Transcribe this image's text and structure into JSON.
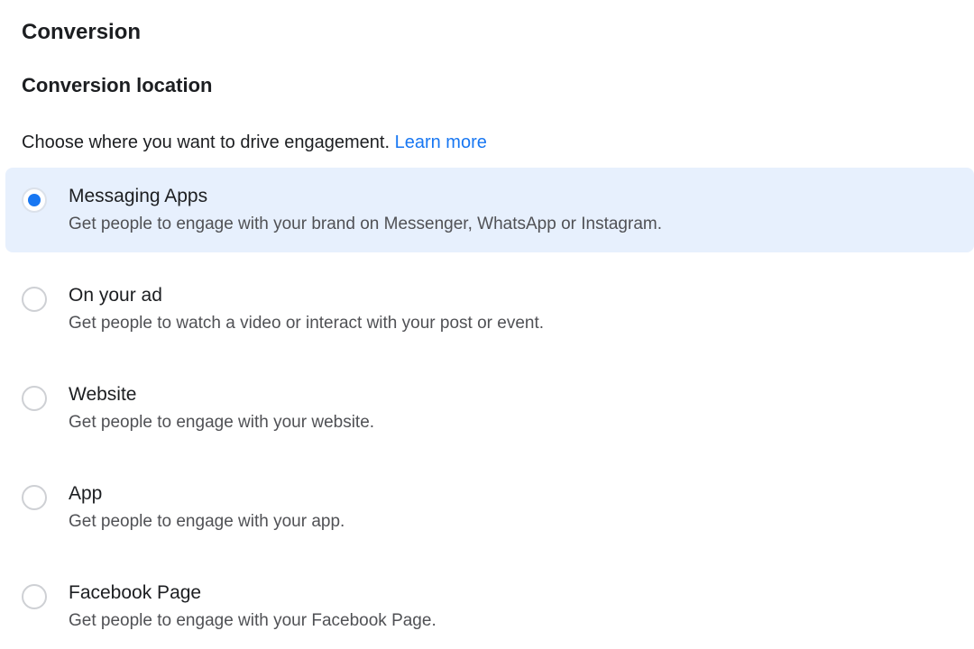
{
  "section_title": "Conversion",
  "subsection_title": "Conversion location",
  "description": "Choose where you want to drive engagement. ",
  "learn_more": "Learn more",
  "selected_index": 0,
  "options": [
    {
      "title": "Messaging Apps",
      "desc": "Get people to engage with your brand on Messenger, WhatsApp or Instagram."
    },
    {
      "title": "On your ad",
      "desc": "Get people to watch a video or interact with your post or event."
    },
    {
      "title": "Website",
      "desc": "Get people to engage with your website."
    },
    {
      "title": "App",
      "desc": "Get people to engage with your app."
    },
    {
      "title": "Facebook Page",
      "desc": "Get people to engage with your Facebook Page."
    }
  ]
}
